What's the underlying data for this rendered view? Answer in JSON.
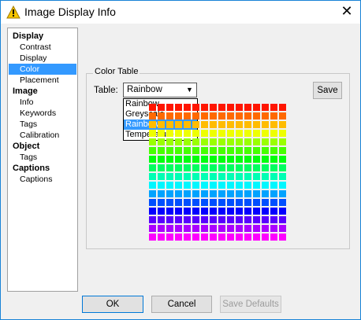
{
  "window": {
    "title": "Image Display Info",
    "close_glyph": "✕",
    "title_icon": "warning-triangle-icon"
  },
  "sidebar": {
    "items": [
      {
        "label": "Display",
        "kind": "group"
      },
      {
        "label": "Contrast",
        "kind": "item"
      },
      {
        "label": "Display",
        "kind": "item"
      },
      {
        "label": "Color",
        "kind": "item",
        "selected": true
      },
      {
        "label": "Placement",
        "kind": "item"
      },
      {
        "label": "Image",
        "kind": "group"
      },
      {
        "label": "Info",
        "kind": "item"
      },
      {
        "label": "Keywords",
        "kind": "item"
      },
      {
        "label": "Tags",
        "kind": "item"
      },
      {
        "label": "Calibration",
        "kind": "item"
      },
      {
        "label": "Object",
        "kind": "group"
      },
      {
        "label": "Tags",
        "kind": "item"
      },
      {
        "label": "Captions",
        "kind": "group"
      },
      {
        "label": "Captions",
        "kind": "item"
      }
    ]
  },
  "color_table": {
    "group_label": "Color Table",
    "table_label": "Table:",
    "selected": "Rainbow",
    "options": [
      "Rainbow",
      "Greyscale",
      "Rainbow",
      "Temperature"
    ],
    "highlighted_option": 2,
    "save_label": "Save",
    "swatch_rows": 16,
    "swatch_cols": 16
  },
  "footer": {
    "ok_label": "OK",
    "cancel_label": "Cancel",
    "defaults_label": "Save Defaults"
  },
  "colors": {
    "accent": "#3399ff",
    "window_border": "#1883d7",
    "ok_border": "#0078d7"
  }
}
